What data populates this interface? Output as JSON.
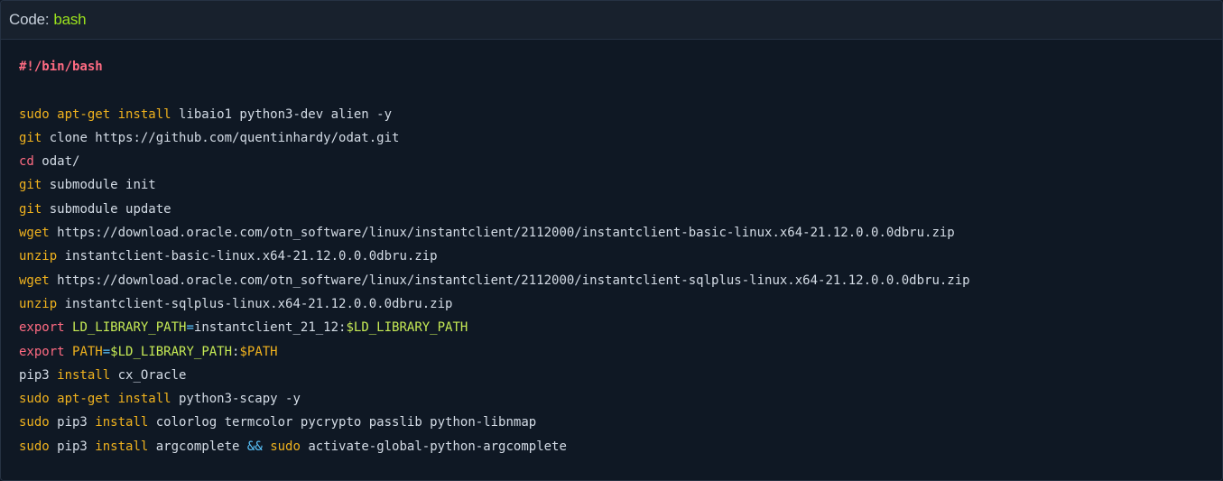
{
  "header": {
    "label": "Code:",
    "language": "bash"
  },
  "code": {
    "lines": [
      {
        "parts": [
          {
            "text": "#!/bin/bash",
            "kind": "shebang"
          }
        ]
      },
      {
        "parts": [
          {
            "text": "",
            "kind": "plain"
          }
        ]
      },
      {
        "parts": [
          {
            "text": "sudo apt-get install",
            "kind": "kw"
          },
          {
            "text": " libaio1 python3-dev alien -y",
            "kind": "plain"
          }
        ]
      },
      {
        "parts": [
          {
            "text": "git",
            "kind": "git"
          },
          {
            "text": " clone https://github.com/quentinhardy/odat.git",
            "kind": "plain"
          }
        ]
      },
      {
        "parts": [
          {
            "text": "cd",
            "kind": "builtin"
          },
          {
            "text": " odat/",
            "kind": "plain"
          }
        ]
      },
      {
        "parts": [
          {
            "text": "git",
            "kind": "git"
          },
          {
            "text": " submodule init",
            "kind": "plain"
          }
        ]
      },
      {
        "parts": [
          {
            "text": "git",
            "kind": "git"
          },
          {
            "text": " submodule update",
            "kind": "plain"
          }
        ]
      },
      {
        "parts": [
          {
            "text": "wget",
            "kind": "kw"
          },
          {
            "text": " https://download.oracle.com/otn_software/linux/instantclient/2112000/instantclient-basic-linux.x64-21.12.0.0.0dbru.zip",
            "kind": "plain"
          }
        ]
      },
      {
        "parts": [
          {
            "text": "unzip",
            "kind": "kw"
          },
          {
            "text": " instantclient-basic-linux.x64-21.12.0.0.0dbru.zip",
            "kind": "plain"
          }
        ]
      },
      {
        "parts": [
          {
            "text": "wget",
            "kind": "kw"
          },
          {
            "text": " https://download.oracle.com/otn_software/linux/instantclient/2112000/instantclient-sqlplus-linux.x64-21.12.0.0.0dbru.zip",
            "kind": "plain"
          }
        ]
      },
      {
        "parts": [
          {
            "text": "unzip",
            "kind": "kw"
          },
          {
            "text": " instantclient-sqlplus-linux.x64-21.12.0.0.0dbru.zip",
            "kind": "plain"
          }
        ]
      },
      {
        "parts": [
          {
            "text": "export",
            "kind": "builtin"
          },
          {
            "text": " ",
            "kind": "plain"
          },
          {
            "text": "LD_LIBRARY_PATH",
            "kind": "green"
          },
          {
            "text": "=",
            "kind": "op"
          },
          {
            "text": "instantclient_21_12:",
            "kind": "plain"
          },
          {
            "text": "$LD_LIBRARY_PATH",
            "kind": "green"
          }
        ]
      },
      {
        "parts": [
          {
            "text": "export",
            "kind": "builtin"
          },
          {
            "text": " ",
            "kind": "plain"
          },
          {
            "text": "PATH",
            "kind": "kw"
          },
          {
            "text": "=",
            "kind": "op"
          },
          {
            "text": "$LD_LIBRARY_PATH",
            "kind": "green"
          },
          {
            "text": ":",
            "kind": "plain"
          },
          {
            "text": "$PATH",
            "kind": "kw"
          }
        ]
      },
      {
        "parts": [
          {
            "text": "pip3",
            "kind": "plain"
          },
          {
            "text": " install",
            "kind": "kw"
          },
          {
            "text": " cx_Oracle",
            "kind": "plain"
          }
        ]
      },
      {
        "parts": [
          {
            "text": "sudo apt-get install",
            "kind": "kw"
          },
          {
            "text": " python3-scapy -y",
            "kind": "plain"
          }
        ]
      },
      {
        "parts": [
          {
            "text": "sudo",
            "kind": "kw"
          },
          {
            "text": " pip3 ",
            "kind": "plain"
          },
          {
            "text": "install",
            "kind": "kw"
          },
          {
            "text": " colorlog termcolor pycrypto passlib python-libnmap",
            "kind": "plain"
          }
        ]
      },
      {
        "parts": [
          {
            "text": "sudo",
            "kind": "kw"
          },
          {
            "text": " pip3 ",
            "kind": "plain"
          },
          {
            "text": "install",
            "kind": "kw"
          },
          {
            "text": " argcomplete ",
            "kind": "plain"
          },
          {
            "text": "&&",
            "kind": "op"
          },
          {
            "text": " ",
            "kind": "plain"
          },
          {
            "text": "sudo",
            "kind": "kw"
          },
          {
            "text": " activate-global-python-argcomplete",
            "kind": "plain"
          }
        ]
      }
    ]
  },
  "colors": {
    "background": "#0f1824",
    "header_background": "#18212d",
    "header_text": "#c7d0db",
    "language": "#9be21d",
    "shebang": "#ff6b82",
    "keyword": "#f0b21e",
    "builtin": "#ff6b82",
    "green": "#c6ea55",
    "operator": "#5bc6ff",
    "plain": "#d4dce6"
  }
}
